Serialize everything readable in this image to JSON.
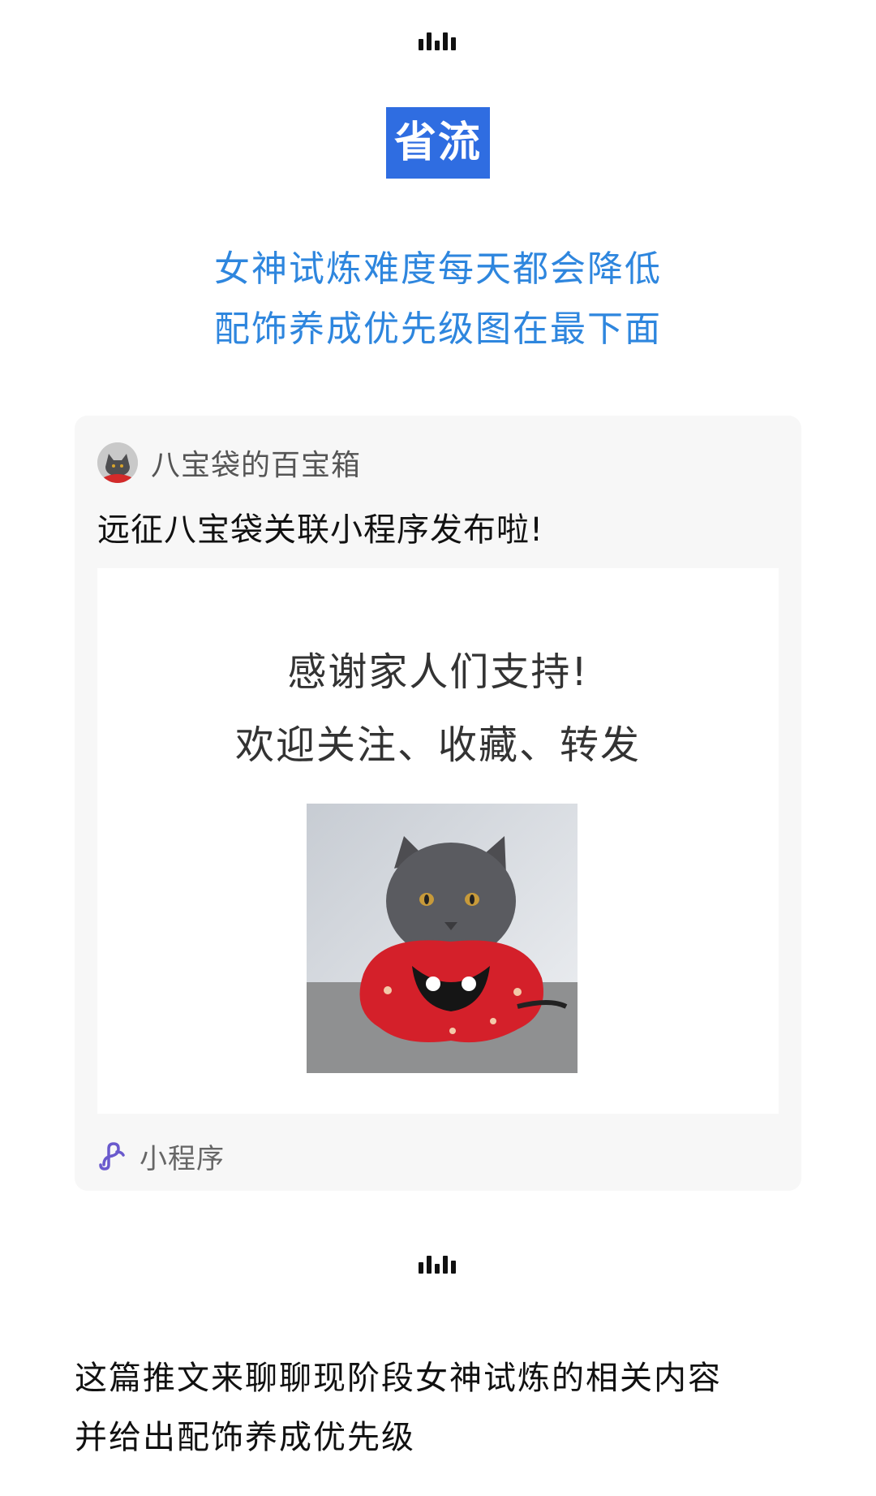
{
  "header": {
    "divider_icon": "audio-bars-icon",
    "title": "省流",
    "title_bg": "#2f6de1",
    "intro_lines": [
      "女神试炼难度每天都会降低",
      "配饰养成优先级图在最下面"
    ],
    "accent_color": "#2e86de"
  },
  "card": {
    "account_name": "八宝袋的百宝箱",
    "title": "远征八宝袋关联小程序发布啦!",
    "image_text": [
      "感谢家人们支持!",
      "欢迎关注、收藏、转发"
    ],
    "footer_icon": "mini-program-link-icon",
    "footer_label": "小程序"
  },
  "body": {
    "lines": [
      "这篇推文来聊聊现阶段女神试炼的相关内容",
      "并给出配饰养成优先级"
    ]
  }
}
